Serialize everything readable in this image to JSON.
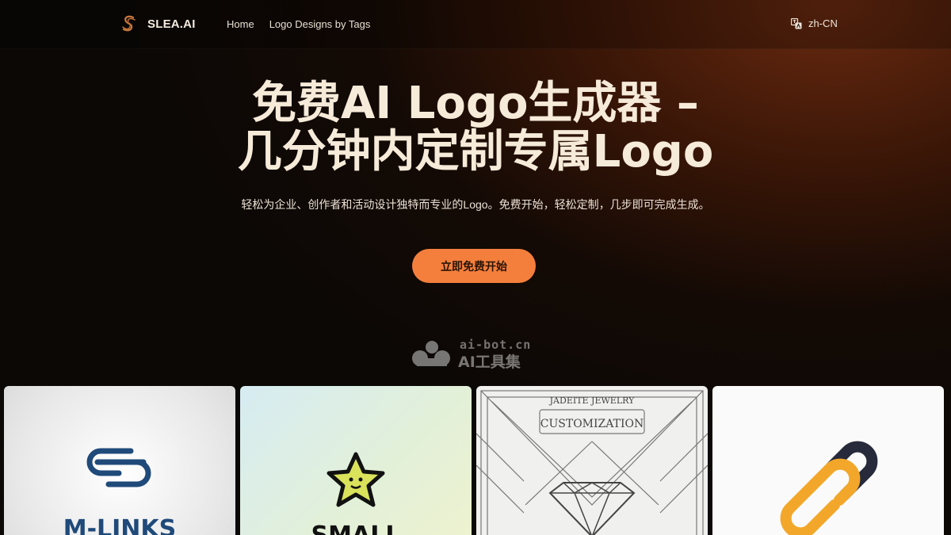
{
  "header": {
    "brand": "SLEA.AI",
    "brand_icon": "slea-s-logo-icon",
    "nav": [
      "Home",
      "Logo Designs by Tags"
    ],
    "language": "zh-CN",
    "language_icon": "translate-icon"
  },
  "hero": {
    "title_line1": "免费AI Logo生成器 –",
    "title_line2": "几分钟内定制专属Logo",
    "subtitle": "轻松为企业、创作者和活动设计独特而专业的Logo。免费开始，轻松定制，几步即可完成生成。",
    "cta": "立即免费开始"
  },
  "watermark": {
    "url": "ai-bot.cn",
    "name": "AI工具集"
  },
  "gallery": {
    "cards": [
      {
        "icon": "chain-links-logo-icon",
        "text": "M-LINKS"
      },
      {
        "icon": "smiling-star-logo-icon",
        "text": "SMALL"
      },
      {
        "icon": "diamond-logo-icon",
        "line1": "JADEITE JEWELRY",
        "line2": "CUSTOMIZATION"
      },
      {
        "icon": "interlocking-links-logo-icon"
      }
    ]
  },
  "colors": {
    "accent": "#f47f3c",
    "text": "#f6ead9",
    "background_dark": "#0b0806",
    "background_glow": "#6a2a10"
  }
}
